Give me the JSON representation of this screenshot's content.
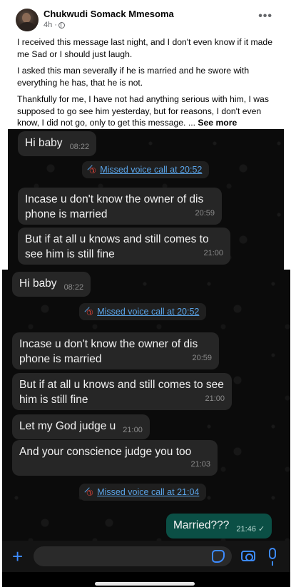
{
  "post": {
    "author": "Chukwudi Somack Mmesoma",
    "time": "4h ·",
    "more_label": "•••",
    "paragraphs": [
      "I received this message last night, and I don't even know if it made me Sad or I should just laugh.",
      "I asked this man severally if he is married and he swore with everything he has, that he is not.",
      "Thankfully for me, I have not had anything serious with him, I was supposed to go see him yesterday, but for reasons, I don't even know, I did not go, only to get this message. ..."
    ],
    "see_more": "See more"
  },
  "chat_top": {
    "messages": [
      {
        "text": "Hi baby",
        "time": "08:22"
      },
      {
        "missed_call": "Missed voice call at 20:52"
      },
      {
        "text": "Incase u don't know the owner of dis phone is married",
        "time": "20:59"
      },
      {
        "text": "But if at all u knows and still comes to see him is still fine",
        "time": "21:00"
      }
    ]
  },
  "chat_bottom": {
    "messages": [
      {
        "text": "Hi baby",
        "time": "08:22"
      },
      {
        "missed_call": "Missed voice call at 20:52"
      },
      {
        "text": "Incase u don't know the owner of dis phone is married",
        "time": "20:59"
      },
      {
        "text": "But if at all u knows and still comes to see him is still fine",
        "time": "21:00"
      },
      {
        "text": "Let my God judge u",
        "time": "21:00"
      },
      {
        "text": "And your conscience judge you too",
        "time": "21:03"
      },
      {
        "missed_call": "Missed voice call at 21:04"
      },
      {
        "text": "Married???",
        "time": "21:46",
        "status": "✓"
      }
    ]
  },
  "icons": {
    "missed_call": "missed-call-icon",
    "plus": "+",
    "sticker": "sticker-icon",
    "camera": "camera-icon",
    "mic": "mic-icon"
  },
  "colors": {
    "link_blue": "#5aa3e6",
    "missed_red": "#e0453a",
    "outgoing_bubble": "#0b4f45",
    "accent_blue": "#3d8bff"
  }
}
